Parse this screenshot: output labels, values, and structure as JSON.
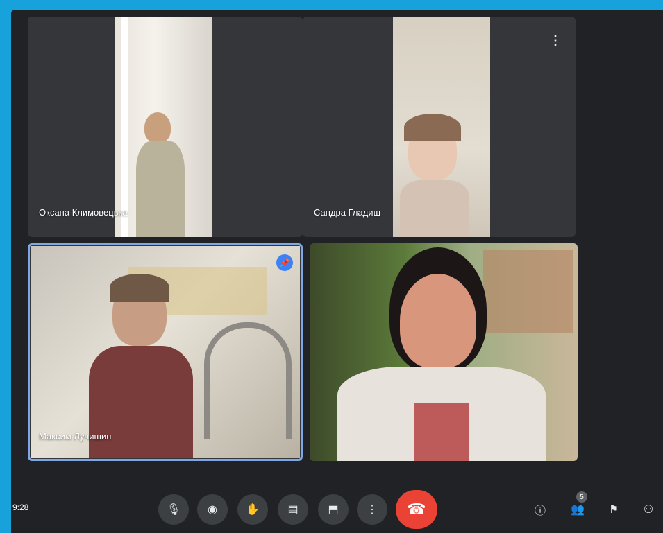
{
  "participants": [
    {
      "name": "Оксана Климовецька"
    },
    {
      "name": "Сандра Гладиш"
    },
    {
      "name": "Максим Лучишин"
    },
    {
      "name": ""
    }
  ],
  "tile_more_icon": "more-vert-icon",
  "pin_icon": "pin-icon",
  "controls": {
    "meeting_time": "9:28",
    "buttons": [
      {
        "name": "mic-button",
        "icon": "mic-icon",
        "glyph": "🎙"
      },
      {
        "name": "camera-button",
        "icon": "camera-icon",
        "glyph": "◉"
      },
      {
        "name": "raise-hand-button",
        "icon": "hand-icon",
        "glyph": "✋"
      },
      {
        "name": "captions-button",
        "icon": "captions-icon",
        "glyph": "▤"
      },
      {
        "name": "present-button",
        "icon": "present-icon",
        "glyph": "⬒"
      },
      {
        "name": "more-options-button",
        "icon": "more-vert-icon",
        "glyph": "⋮"
      }
    ],
    "end_call_glyph": "☎",
    "side": [
      {
        "name": "info-button",
        "icon": "info-icon",
        "glyph": "ⓘ"
      },
      {
        "name": "people-button",
        "icon": "people-icon",
        "glyph": "👥",
        "badge": "5"
      },
      {
        "name": "activities-button",
        "icon": "activities-icon",
        "glyph": "⚑"
      },
      {
        "name": "host-controls-button",
        "icon": "lock-person-icon",
        "glyph": "⚇"
      }
    ]
  },
  "colors": {
    "background": "#202226",
    "frame": "#17a2dc",
    "end_call": "#ea4335",
    "active_speaker": "#7fa7e6"
  }
}
